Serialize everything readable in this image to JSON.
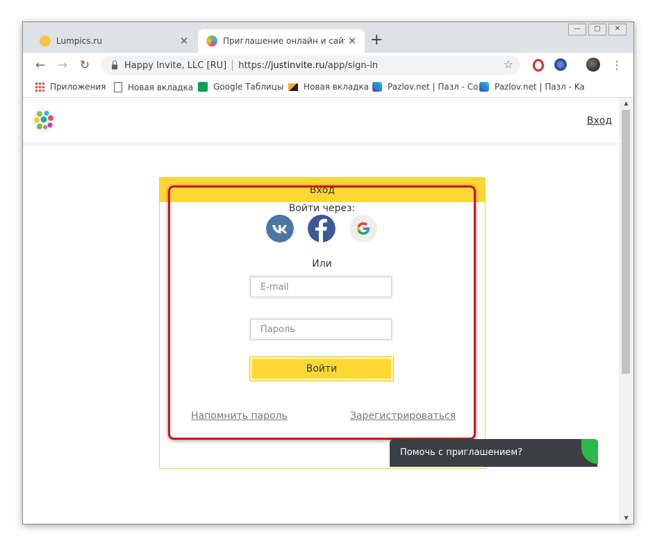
{
  "browser": {
    "tabs": [
      {
        "title": "Lumpics.ru",
        "active": false
      },
      {
        "title": "Приглашение онлайн и сайт ме",
        "active": true
      }
    ],
    "new_tab_symbol": "+",
    "window_buttons": {
      "minimize": "—",
      "maximize": "▢",
      "close": "✕"
    },
    "address": {
      "site_name": "Happy Invite, LLC [RU]",
      "url_prefix": "https://",
      "url_host": "justinvite.ru",
      "url_path": "/app/sign-in"
    },
    "bookmarks": [
      {
        "label": "Приложения",
        "icon": "apps-grid-icon"
      },
      {
        "label": "Новая вкладка",
        "icon": "page-icon"
      },
      {
        "label": "Google Таблицы",
        "icon": "sheets-icon"
      },
      {
        "label": "Новая вкладка",
        "icon": "image-icon"
      },
      {
        "label": "Pazlov.net | Пазл - Co",
        "icon": "puzzle-icon"
      },
      {
        "label": "Pazlov.net | Пазл - Ka",
        "icon": "puzzle-icon"
      }
    ]
  },
  "site": {
    "header_login_link": "Вход"
  },
  "login": {
    "title": "Вход",
    "login_via": "Войти через:",
    "social": [
      "vk",
      "facebook",
      "google"
    ],
    "or_text": "Или",
    "email_placeholder": "E-mail",
    "password_placeholder": "Пароль",
    "submit_label": "Войти",
    "remind_password": "Напомнить пароль",
    "register": "Зарегистрироваться"
  },
  "chat_widget": {
    "label": "Помочь с приглашением?"
  },
  "colors": {
    "accent_yellow": "#fdd835",
    "highlight_red": "#d0101a",
    "vk_blue": "#4a76a8",
    "facebook_blue": "#3b5998",
    "chat_dark": "#3b3e44"
  }
}
